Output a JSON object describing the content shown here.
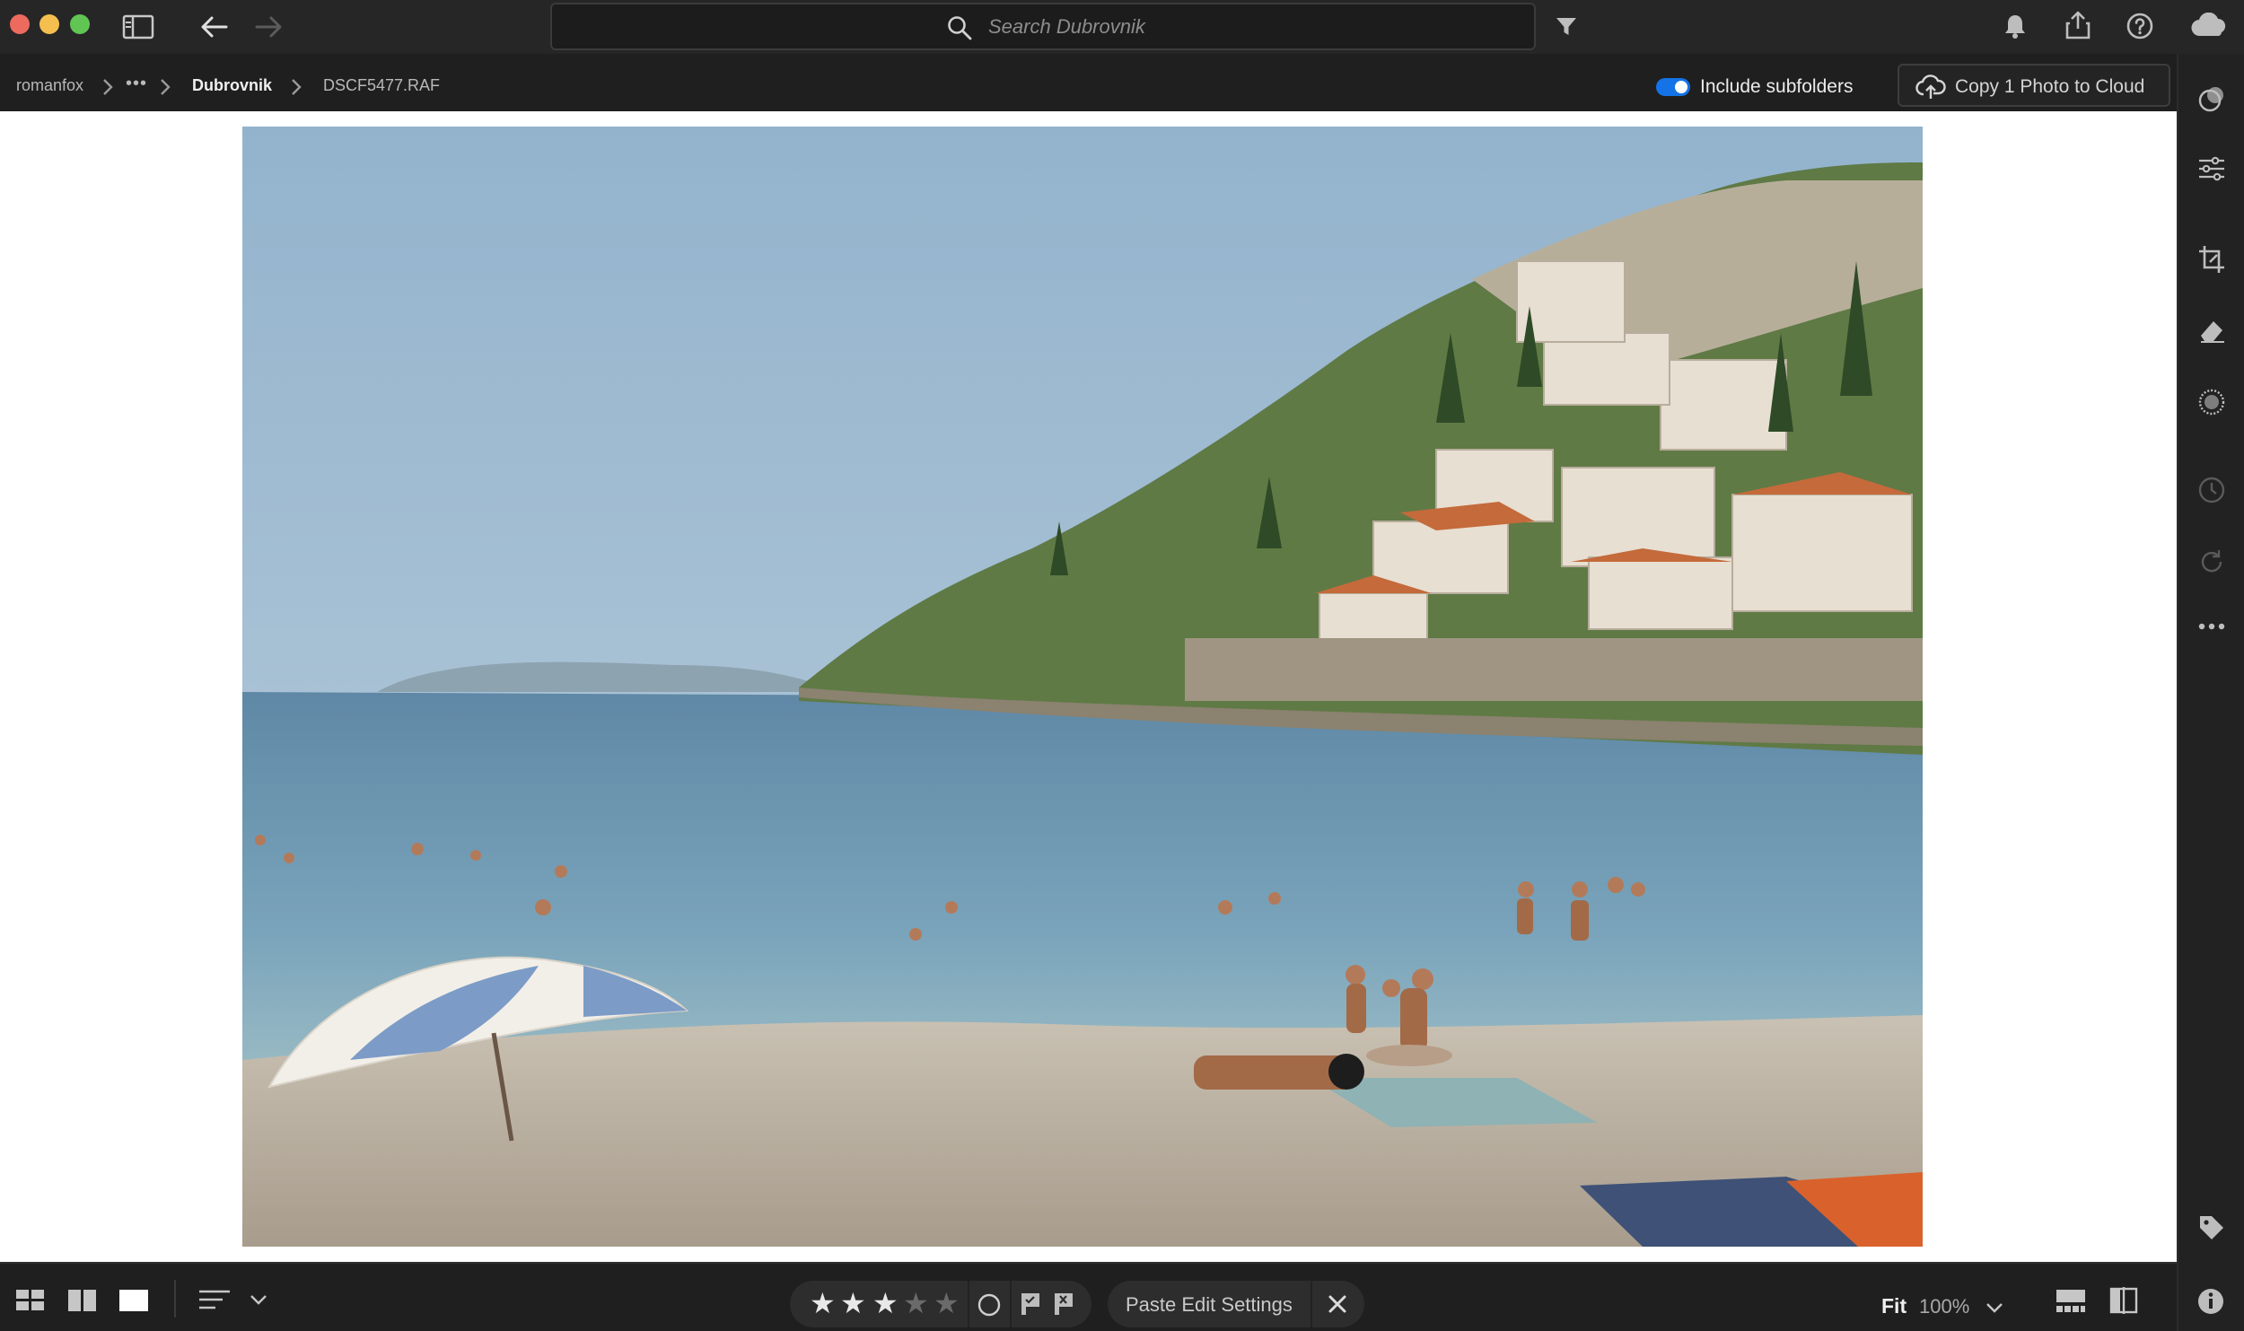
{
  "search": {
    "placeholder": "Search Dubrovnik"
  },
  "breadcrumb": {
    "root": "romanfox",
    "overflow": "•••",
    "folder": "Dubrovnik",
    "file": "DSCF5477.RAF"
  },
  "include_subfolders": {
    "label": "Include subfolders",
    "enabled": true
  },
  "cloud_button": {
    "label": "Copy 1 Photo to Cloud"
  },
  "rating": {
    "stars": 3,
    "max": 5
  },
  "paste_settings": {
    "label": "Paste Edit Settings"
  },
  "zoom": {
    "fit_label": "Fit",
    "level": "100%"
  },
  "colors": {
    "accent": "#1473e6",
    "chrome_bg": "#262626",
    "canvas_bg": "#ffffff"
  },
  "icons": {
    "titlebar": [
      "sidebar-toggle-icon",
      "back-arrow-icon",
      "forward-arrow-icon",
      "search-icon",
      "filter-icon",
      "bell-icon",
      "share-icon",
      "help-icon",
      "cloud-status-icon"
    ],
    "rail": [
      "profile-icon",
      "edit-sliders-icon",
      "crop-icon",
      "healing-eraser-icon",
      "masking-icon",
      "history-icon",
      "versions-icon",
      "more-icon",
      "keywords-tag-icon",
      "info-icon"
    ],
    "bottom": [
      "grid-view-icon",
      "square-grid-view-icon",
      "detail-view-icon",
      "sort-icon",
      "sort-dropdown-icon",
      "reject-circle-icon",
      "flag-pick-icon",
      "flag-reject-icon",
      "close-icon",
      "filmstrip-icon",
      "compare-icon"
    ]
  }
}
